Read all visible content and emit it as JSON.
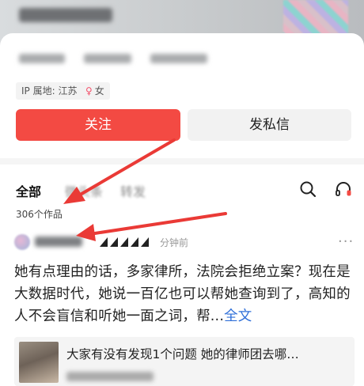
{
  "profile": {
    "ip_location": "IP 属地: 江苏",
    "gender_symbol": "♀",
    "gender": "女"
  },
  "actions": {
    "follow": "关注",
    "message": "发私信"
  },
  "tabs": [
    {
      "label": "全部",
      "active": true
    },
    {
      "label": "微头条",
      "active": false
    },
    {
      "label": "转发",
      "active": false
    }
  ],
  "works_count": "306个作品",
  "post": {
    "time": "分钟前",
    "more": "···",
    "text": "她有点理由的话，多家律所，法院会拒绝立案？现在是大数据时代，她说一百亿也可以帮她查询到了，高知的人不会盲信和听她一面之词，帮...",
    "full_text_link": "全文"
  },
  "linked_article": {
    "title": "大家有没有发现1个问题 她的律师团去哪…"
  },
  "colors": {
    "follow_red": "#f34a43",
    "annotation_arrow": "#ea3a36",
    "full_text_blue": "#2f6fd8"
  },
  "icons": [
    "search-icon",
    "headset-icon",
    "female-icon",
    "more-icon"
  ]
}
